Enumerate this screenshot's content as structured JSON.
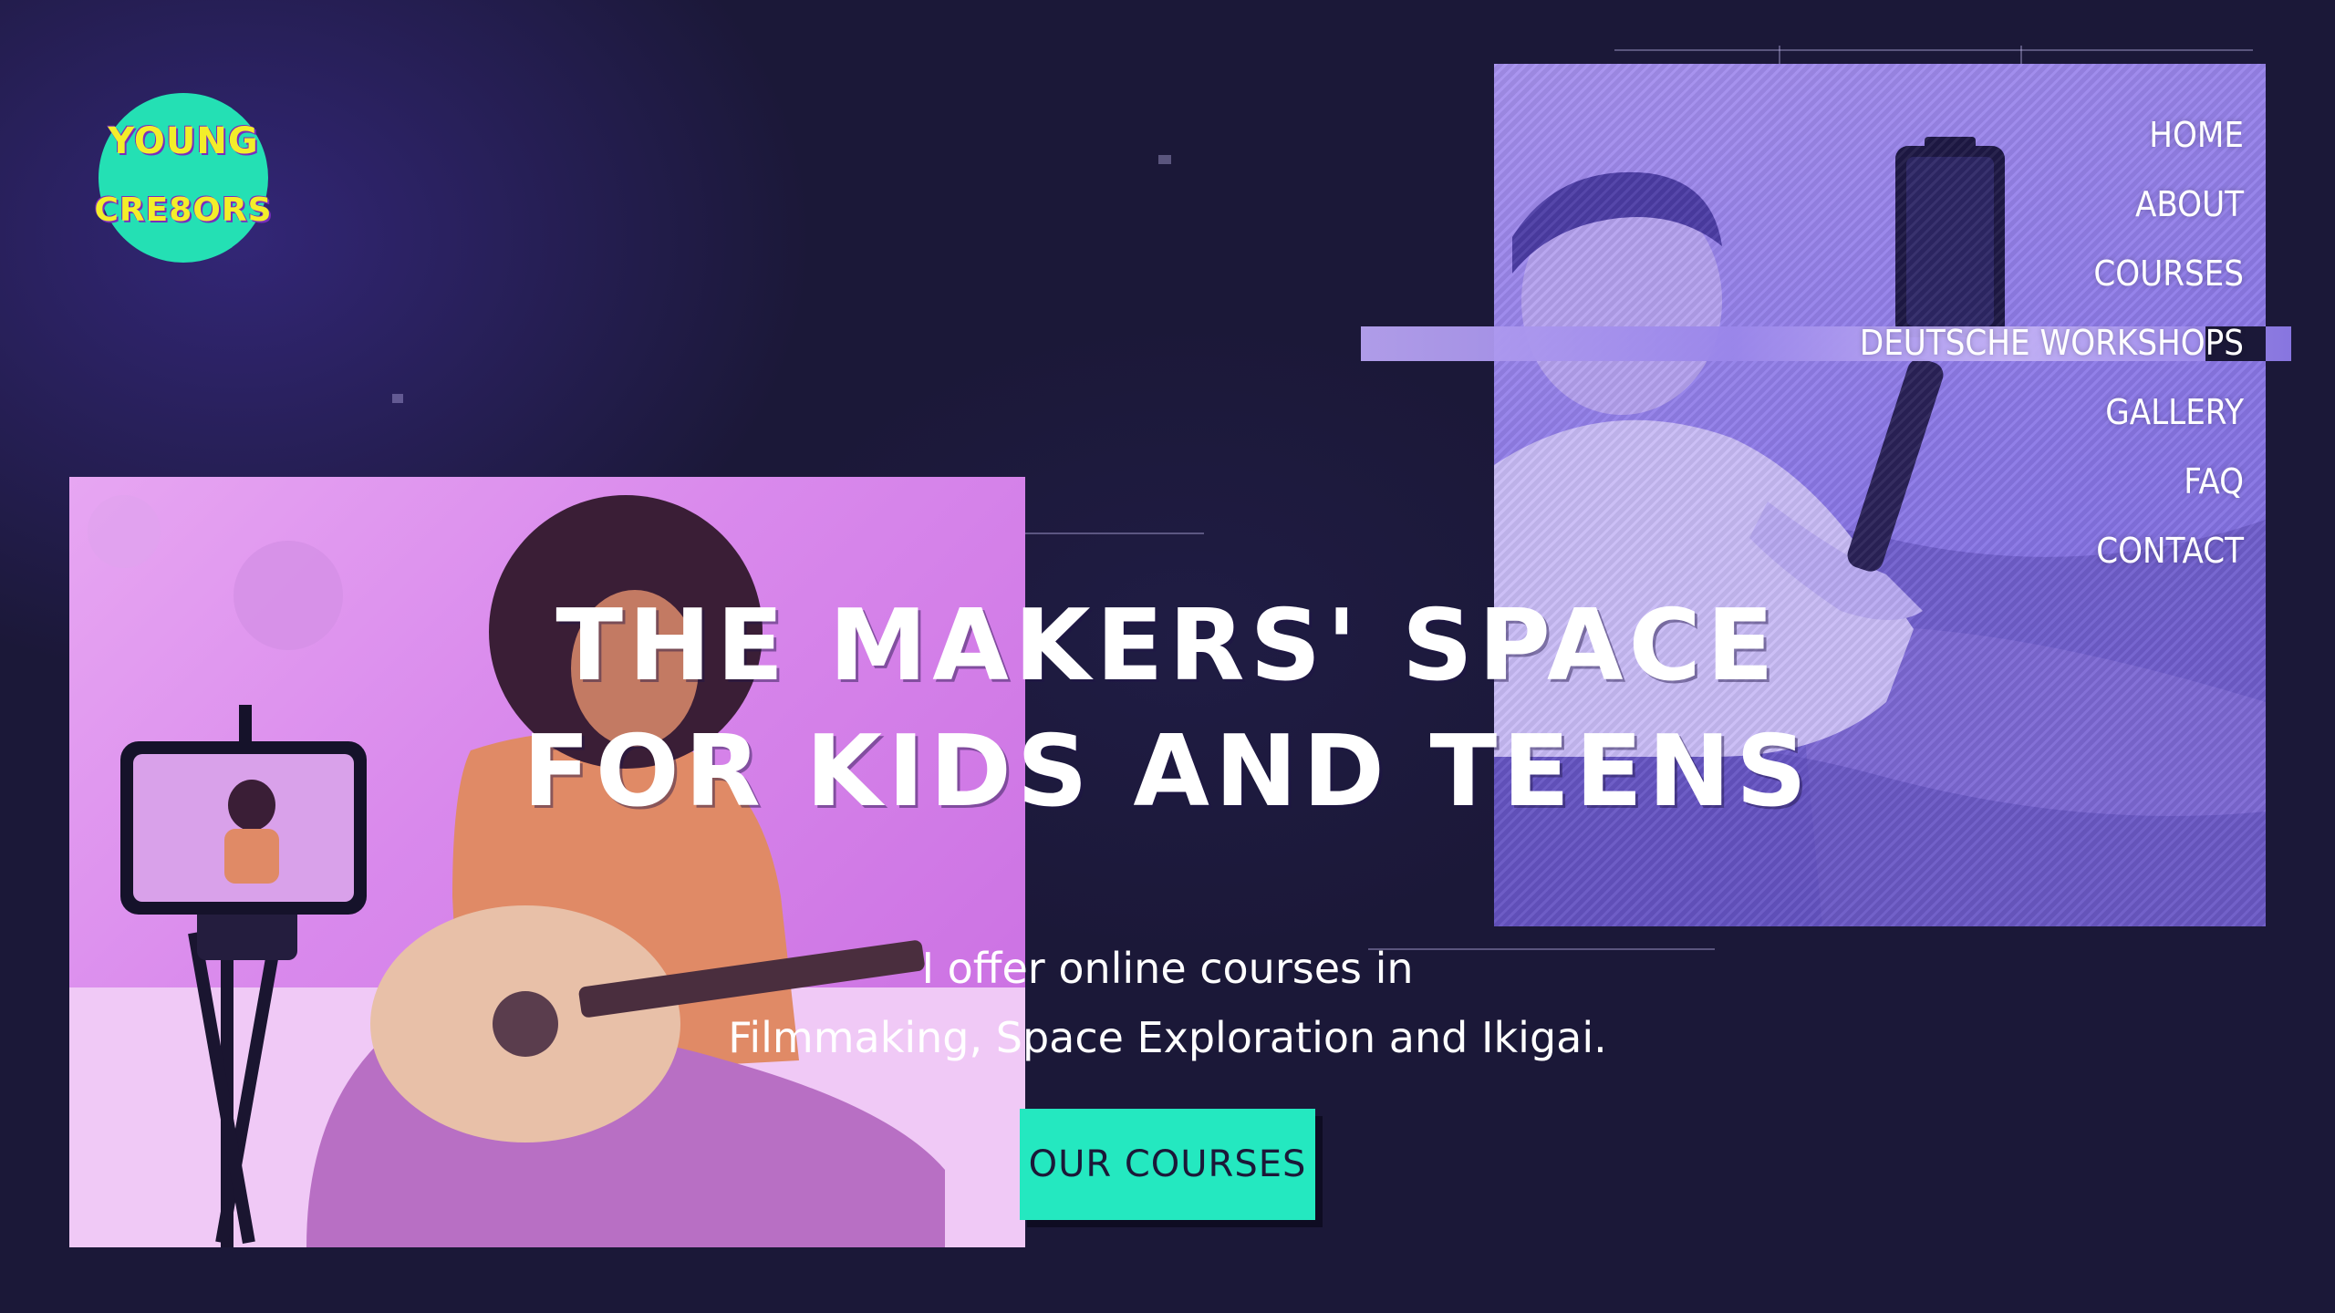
{
  "logo": {
    "line1": "Young",
    "line2": "Cre8ors",
    "colors": {
      "badge": "#24e0b4",
      "text": "#f3ee2a",
      "outline": "#7a2dbd"
    }
  },
  "nav": {
    "items": [
      {
        "label": "HOME"
      },
      {
        "label": "ABOUT"
      },
      {
        "label": "COURSES"
      },
      {
        "label": "DEUTSCHE WORKSHOPS"
      },
      {
        "label": "GALLERY"
      },
      {
        "label": "FAQ"
      },
      {
        "label": "CONTACT"
      }
    ]
  },
  "hero": {
    "title_line1": "THE MAKERS' SPACE",
    "title_line2": "FOR KIDS AND TEENS",
    "subtitle_line1": "I offer online courses in",
    "subtitle_line2": "Filmmaking, Space Exploration and Ikigai.",
    "cta_label": "OUR COURSES"
  },
  "images": {
    "left_photo": "girl-playing-guitar-filmed-by-phone-on-tripod",
    "right_photo": "boy-holding-phone-on-selfie-stick-by-the-sea"
  },
  "colors": {
    "background": "#1b1838",
    "cta": "#24e8c0",
    "left_tint": "#e29cf0",
    "right_tint": "#8d7ae8"
  }
}
